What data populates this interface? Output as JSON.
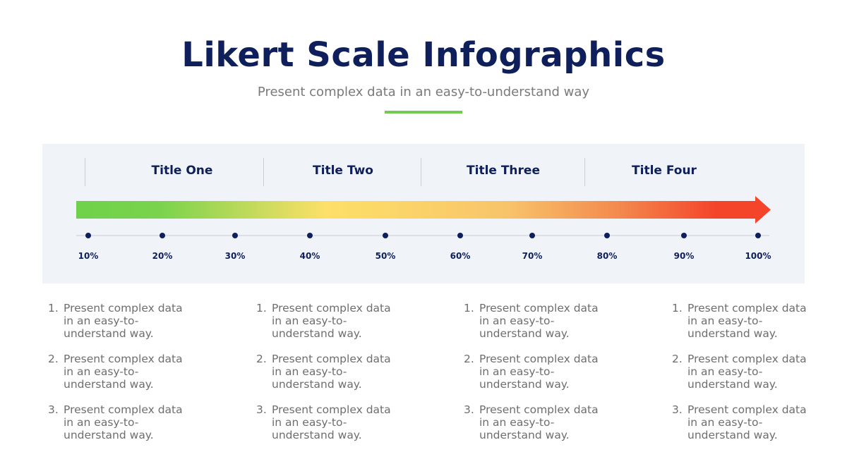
{
  "header": {
    "title": "Likert Scale Infographics",
    "subtitle": "Present complex data in an easy-to-understand way"
  },
  "colors": {
    "title": "#0e1f5b",
    "accent_green": "#74c94f",
    "panel_bg": "#f0f3f7",
    "gradient_start": "#6fd14a",
    "gradient_mid": "#fde068",
    "gradient_end": "#f4452a",
    "dot": "#0e1f5b",
    "body_text": "#6e6e6e"
  },
  "scale": {
    "sections": [
      {
        "label": "Title One"
      },
      {
        "label": "Title Two"
      },
      {
        "label": "Title Three"
      },
      {
        "label": "Title Four"
      }
    ],
    "ticks": [
      "10%",
      "20%",
      "30%",
      "40%",
      "50%",
      "60%",
      "70%",
      "80%",
      "90%",
      "100%"
    ]
  },
  "columns": [
    {
      "items": [
        {
          "num": "1.",
          "text": "Present complex data in an easy-to-understand way."
        },
        {
          "num": "2.",
          "text": "Present complex data in an easy-to-understand way."
        },
        {
          "num": "3.",
          "text": "Present complex data in an easy-to-understand way."
        }
      ]
    },
    {
      "items": [
        {
          "num": "1.",
          "text": "Present complex data in an easy-to-understand way."
        },
        {
          "num": "2.",
          "text": "Present complex data in an easy-to-understand way."
        },
        {
          "num": "3.",
          "text": "Present complex data in an easy-to-understand way."
        }
      ]
    },
    {
      "items": [
        {
          "num": "1.",
          "text": "Present complex data in an easy-to-understand way."
        },
        {
          "num": "2.",
          "text": "Present complex data in an easy-to-understand way."
        },
        {
          "num": "3.",
          "text": "Present complex data in an easy-to-understand way."
        }
      ]
    },
    {
      "items": [
        {
          "num": "1.",
          "text": "Present complex data in an easy-to-understand way."
        },
        {
          "num": "2.",
          "text": "Present complex data in an easy-to-understand way."
        },
        {
          "num": "3.",
          "text": "Present complex data in an easy-to-understand way."
        }
      ]
    }
  ]
}
